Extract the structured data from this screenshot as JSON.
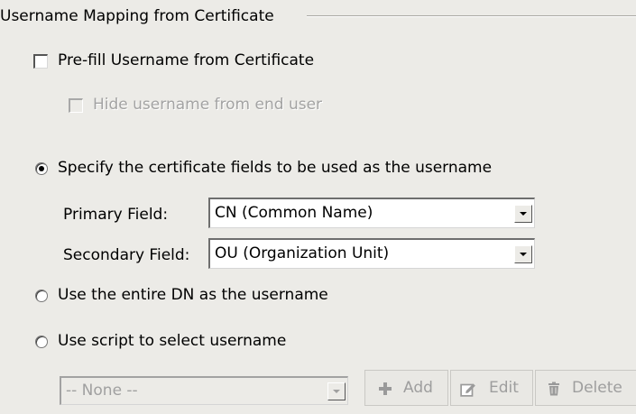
{
  "group": {
    "title": "Username Mapping from Certificate"
  },
  "prefill": {
    "label": "Pre-fill Username from Certificate",
    "checked": false
  },
  "hide_username": {
    "label": "Hide username from end user",
    "checked": false,
    "enabled": false
  },
  "options": {
    "specify_fields": "Specify the certificate fields to be used as the username",
    "entire_dn": "Use the entire DN as the username",
    "script": "Use script to select username",
    "selected": "specify_fields"
  },
  "fields": {
    "primary_label": "Primary Field:",
    "primary_value": "CN (Common Name)",
    "secondary_label": "Secondary Field:",
    "secondary_value": "OU (Organization Unit)"
  },
  "script_select": {
    "value": "-- None --",
    "enabled": false
  },
  "toolbar": {
    "add_label": "Add",
    "edit_label": "Edit",
    "delete_label": "Delete",
    "add_icon": "plus-icon",
    "edit_icon": "edit-icon",
    "delete_icon": "trash-icon"
  }
}
